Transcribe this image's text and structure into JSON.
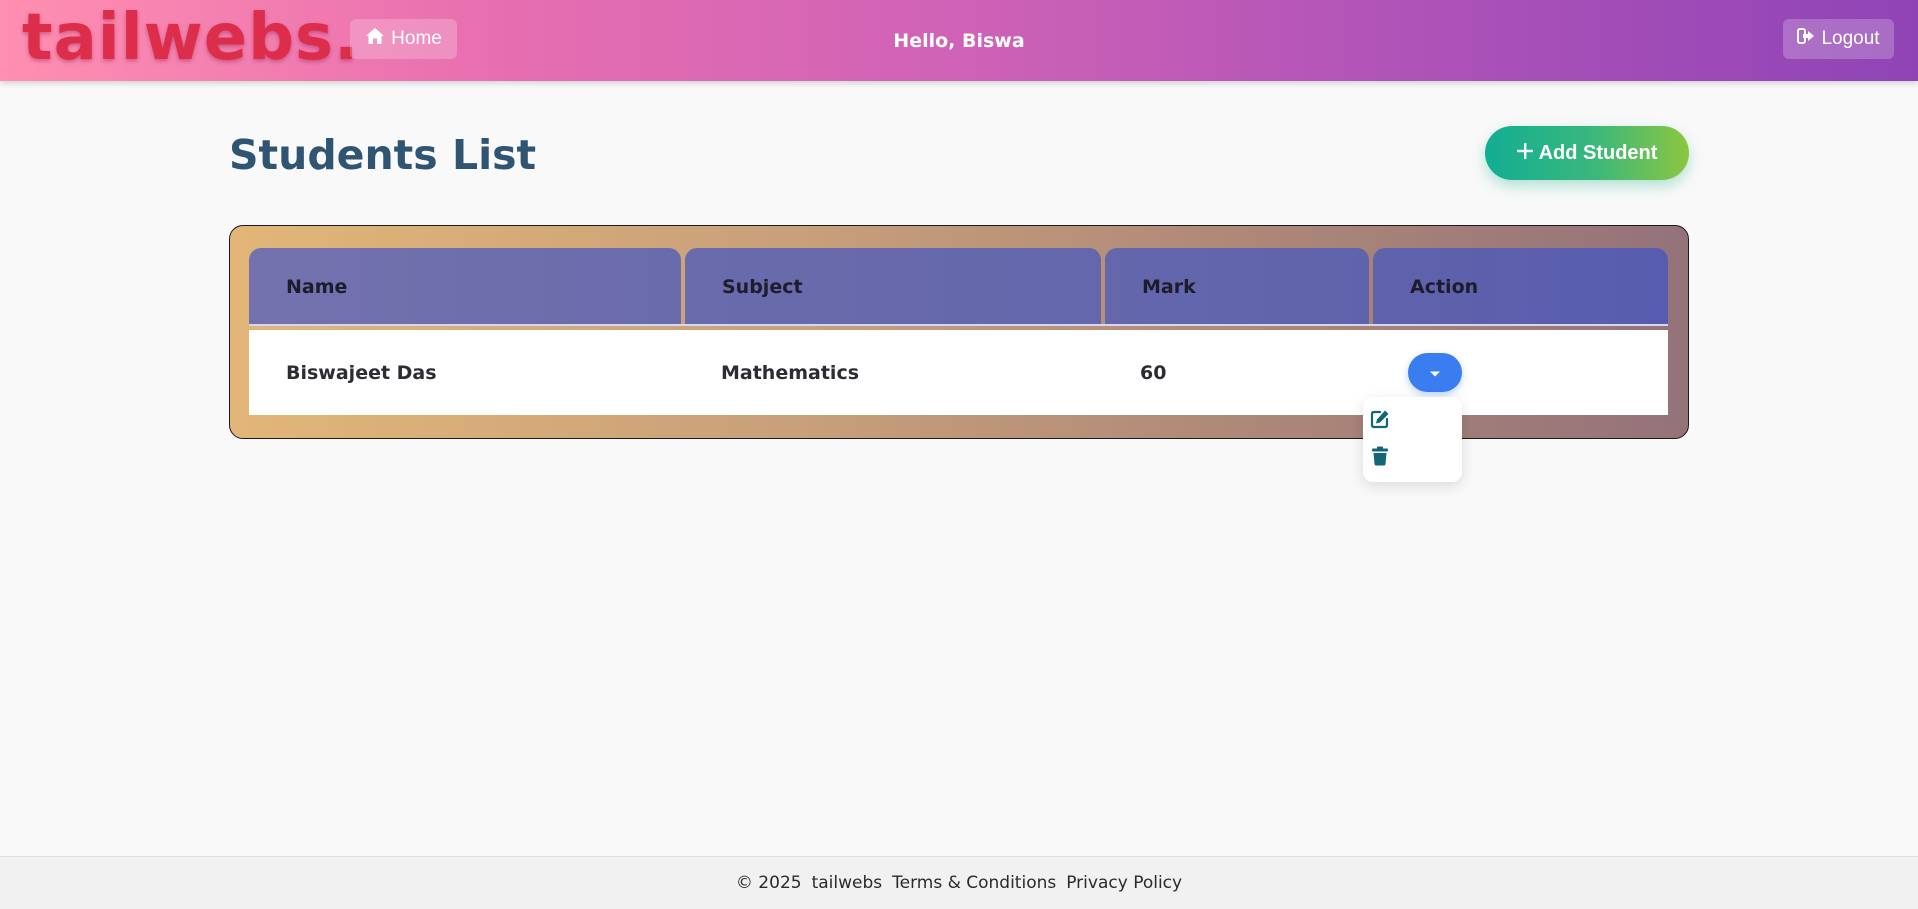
{
  "header": {
    "logo": "tailwebs.",
    "home_label": "Home",
    "greeting": "Hello, Biswa",
    "logout_label": "Logout"
  },
  "main": {
    "title": "Students List",
    "add_button_label": "Add Student"
  },
  "table": {
    "columns": [
      "Name",
      "Subject",
      "Mark",
      "Action"
    ],
    "rows": [
      {
        "name": "Biswajeet Das",
        "subject": "Mathematics",
        "mark": "60"
      }
    ]
  },
  "action_menu": {
    "toggle_icon": "caret-down-icon",
    "items": [
      {
        "icon": "edit-icon"
      },
      {
        "icon": "trash-icon"
      }
    ]
  },
  "footer": {
    "copyright": "© 2025",
    "brand": "tailwebs",
    "terms": "Terms & Conditions",
    "privacy": "Privacy Policy"
  },
  "colors": {
    "header_gradient_start": "#ff8fb1",
    "header_gradient_end": "#8f44b6",
    "logo": "#dc2d4a",
    "title": "#2f5573",
    "add_button_start": "#12ad94",
    "add_button_end": "#8cc63f",
    "toggle_button": "#3a7df0",
    "icon": "#11667a"
  }
}
